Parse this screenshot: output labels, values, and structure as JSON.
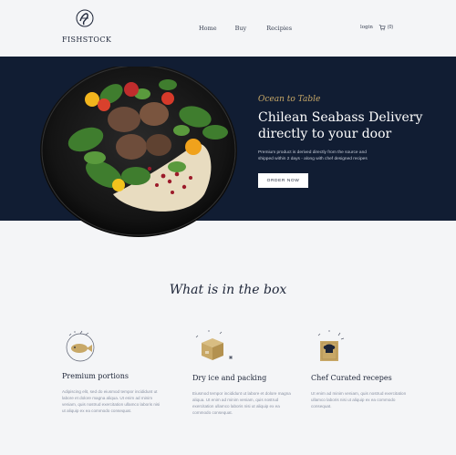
{
  "brand": {
    "name": "FISHSTOCK"
  },
  "nav": {
    "home": "Home",
    "buy": "Buy",
    "recipes": "Recipies"
  },
  "account": {
    "login": "login",
    "cart_count": "(0)"
  },
  "hero": {
    "tagline": "Ocean to Table",
    "title_line1": "Chilean Seabass Delivery",
    "title_line2": "directly to your door",
    "description": "Premium product is derived directly from the source and shipped within 2 days - along with chef designed recipes",
    "button": "ORDER NOW"
  },
  "section": {
    "title": "What is in the box",
    "features": [
      {
        "icon": "fish-icon",
        "title": "Premium portions",
        "description": "Adipiscing elit, sed do eiusmod tempor incididunt ut labore et dolore magna aliqua. Ut enim ad minim veniam, quis nostrud exercitation ullamco laboris nisi ut aliquip ex ea commodo consequat."
      },
      {
        "icon": "box-icon",
        "title": "Dry ice and packing",
        "description": "Eiusmod tempor incididunt ut labore et dolore magna aliqua. Ut enim ad minim veniam, quis nostrud exercitation ullamco laboris nisi ut aliquip ex ea commodo consequat."
      },
      {
        "icon": "chef-book-icon",
        "title": "Chef Curated recepes",
        "description": "Ut enim ad minim veniam, quis nostrud exercitation ullamco laboris nisi ut aliquip ex ea commodo consequat."
      }
    ]
  },
  "colors": {
    "navy": "#111d33",
    "gold": "#c8a867",
    "background": "#f4f5f7"
  }
}
